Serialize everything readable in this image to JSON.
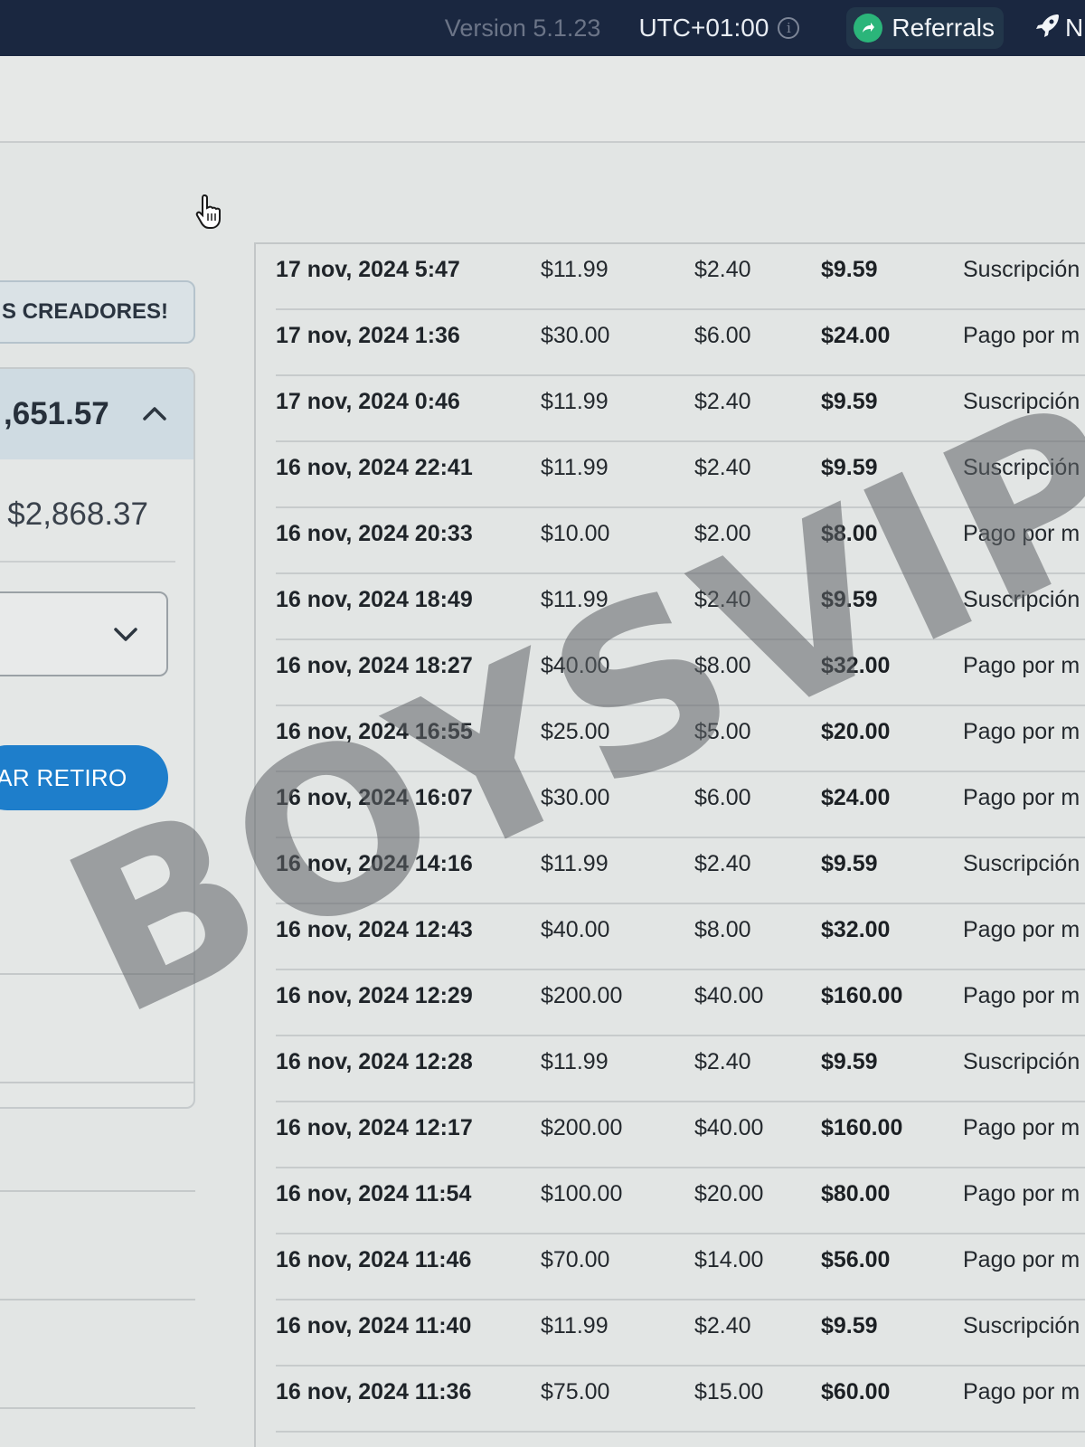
{
  "topbar": {
    "version": "Version 5.1.23",
    "timezone": "UTC+01:00",
    "referrals_label": "Referrals",
    "next_item_partial": "N"
  },
  "sidebar": {
    "promo_label": "S CREADORES!",
    "balance_total": ",651.57",
    "balance_available": "$2,868.37",
    "withdraw_label": "TAR RETIRO"
  },
  "transactions": [
    {
      "date": "17 nov, 2024 5:47",
      "gross": "$11.99",
      "fee": "$2.40",
      "net": "$9.59",
      "type": "Suscripción"
    },
    {
      "date": "17 nov, 2024 1:36",
      "gross": "$30.00",
      "fee": "$6.00",
      "net": "$24.00",
      "type": "Pago por m"
    },
    {
      "date": "17 nov, 2024 0:46",
      "gross": "$11.99",
      "fee": "$2.40",
      "net": "$9.59",
      "type": "Suscripción"
    },
    {
      "date": "16 nov, 2024 22:41",
      "gross": "$11.99",
      "fee": "$2.40",
      "net": "$9.59",
      "type": "Suscripción"
    },
    {
      "date": "16 nov, 2024 20:33",
      "gross": "$10.00",
      "fee": "$2.00",
      "net": "$8.00",
      "type": "Pago por m"
    },
    {
      "date": "16 nov, 2024 18:49",
      "gross": "$11.99",
      "fee": "$2.40",
      "net": "$9.59",
      "type": "Suscripción"
    },
    {
      "date": "16 nov, 2024 18:27",
      "gross": "$40.00",
      "fee": "$8.00",
      "net": "$32.00",
      "type": "Pago por m"
    },
    {
      "date": "16 nov, 2024 16:55",
      "gross": "$25.00",
      "fee": "$5.00",
      "net": "$20.00",
      "type": "Pago por m"
    },
    {
      "date": "16 nov, 2024 16:07",
      "gross": "$30.00",
      "fee": "$6.00",
      "net": "$24.00",
      "type": "Pago por m"
    },
    {
      "date": "16 nov, 2024 14:16",
      "gross": "$11.99",
      "fee": "$2.40",
      "net": "$9.59",
      "type": "Suscripción"
    },
    {
      "date": "16 nov, 2024 12:43",
      "gross": "$40.00",
      "fee": "$8.00",
      "net": "$32.00",
      "type": "Pago por m"
    },
    {
      "date": "16 nov, 2024 12:29",
      "gross": "$200.00",
      "fee": "$40.00",
      "net": "$160.00",
      "type": "Pago por m"
    },
    {
      "date": "16 nov, 2024 12:28",
      "gross": "$11.99",
      "fee": "$2.40",
      "net": "$9.59",
      "type": "Suscripción"
    },
    {
      "date": "16 nov, 2024 12:17",
      "gross": "$200.00",
      "fee": "$40.00",
      "net": "$160.00",
      "type": "Pago por m"
    },
    {
      "date": "16 nov, 2024 11:54",
      "gross": "$100.00",
      "fee": "$20.00",
      "net": "$80.00",
      "type": "Pago por m"
    },
    {
      "date": "16 nov, 2024 11:46",
      "gross": "$70.00",
      "fee": "$14.00",
      "net": "$56.00",
      "type": "Pago por m"
    },
    {
      "date": "16 nov, 2024 11:40",
      "gross": "$11.99",
      "fee": "$2.40",
      "net": "$9.59",
      "type": "Suscripción"
    },
    {
      "date": "16 nov, 2024 11:36",
      "gross": "$75.00",
      "fee": "$15.00",
      "net": "$60.00",
      "type": "Pago por m"
    }
  ],
  "watermark": "BOYSVIP",
  "colors": {
    "topbar_bg": "#1a2740",
    "accent_blue": "#1e7ecb",
    "referral_green": "#2bb57a"
  }
}
